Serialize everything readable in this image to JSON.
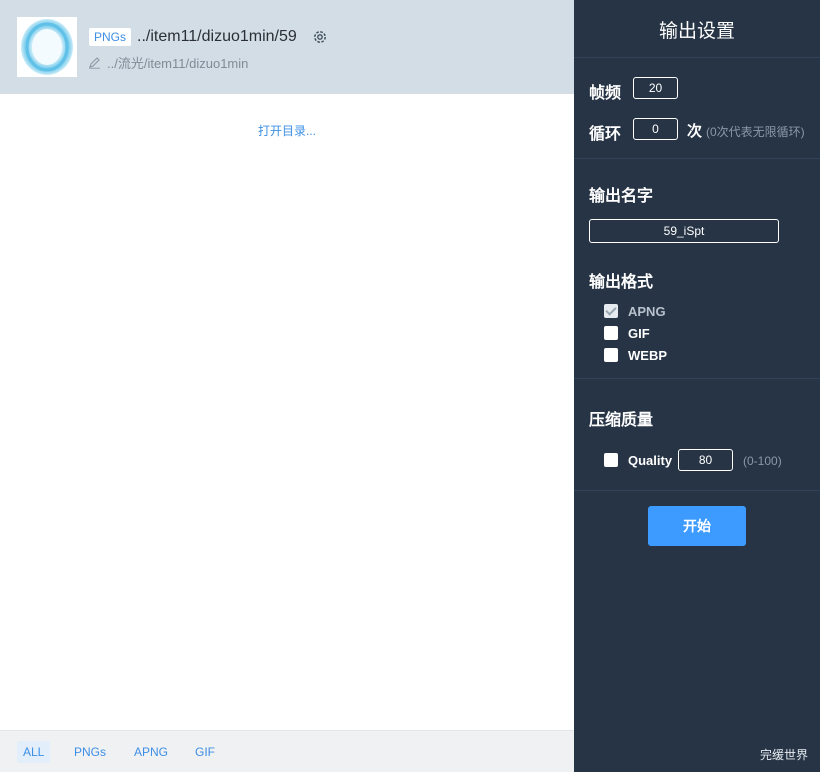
{
  "item": {
    "badge": "PNGs",
    "title": "../item11/dizuo1min/59",
    "path": "../流光/item11/dizuo1min",
    "open_dir": "打开目录..."
  },
  "filters": [
    {
      "label": "ALL",
      "active": true
    },
    {
      "label": "PNGs"
    },
    {
      "label": "APNG"
    },
    {
      "label": "GIF"
    }
  ],
  "settings": {
    "title": "输出设置",
    "fps_label": "帧频",
    "fps_value": "20",
    "loop_label": "循环",
    "loop_value": "0",
    "loop_unit": "次",
    "loop_hint": "(0次代表无限循环)",
    "name_label": "输出名字",
    "name_value": "59_iSpt",
    "format_label": "输出格式",
    "formats": [
      {
        "label": "APNG",
        "checked": true,
        "disabled": true
      },
      {
        "label": "GIF",
        "checked": false
      },
      {
        "label": "WEBP",
        "checked": false
      }
    ],
    "quality_section": "压缩质量",
    "quality_label": "Quality",
    "quality_value": "80",
    "quality_hint": "(0-100)",
    "start_label": "开始"
  },
  "watermark": "完缓世界",
  "colors": {
    "accent": "#3d9bff",
    "panel_bg": "#263445",
    "header_bg": "#d3dde6",
    "link": "#3d8fe6"
  },
  "icons": {
    "settings": "gear-icon",
    "path": "pencil-icon"
  }
}
